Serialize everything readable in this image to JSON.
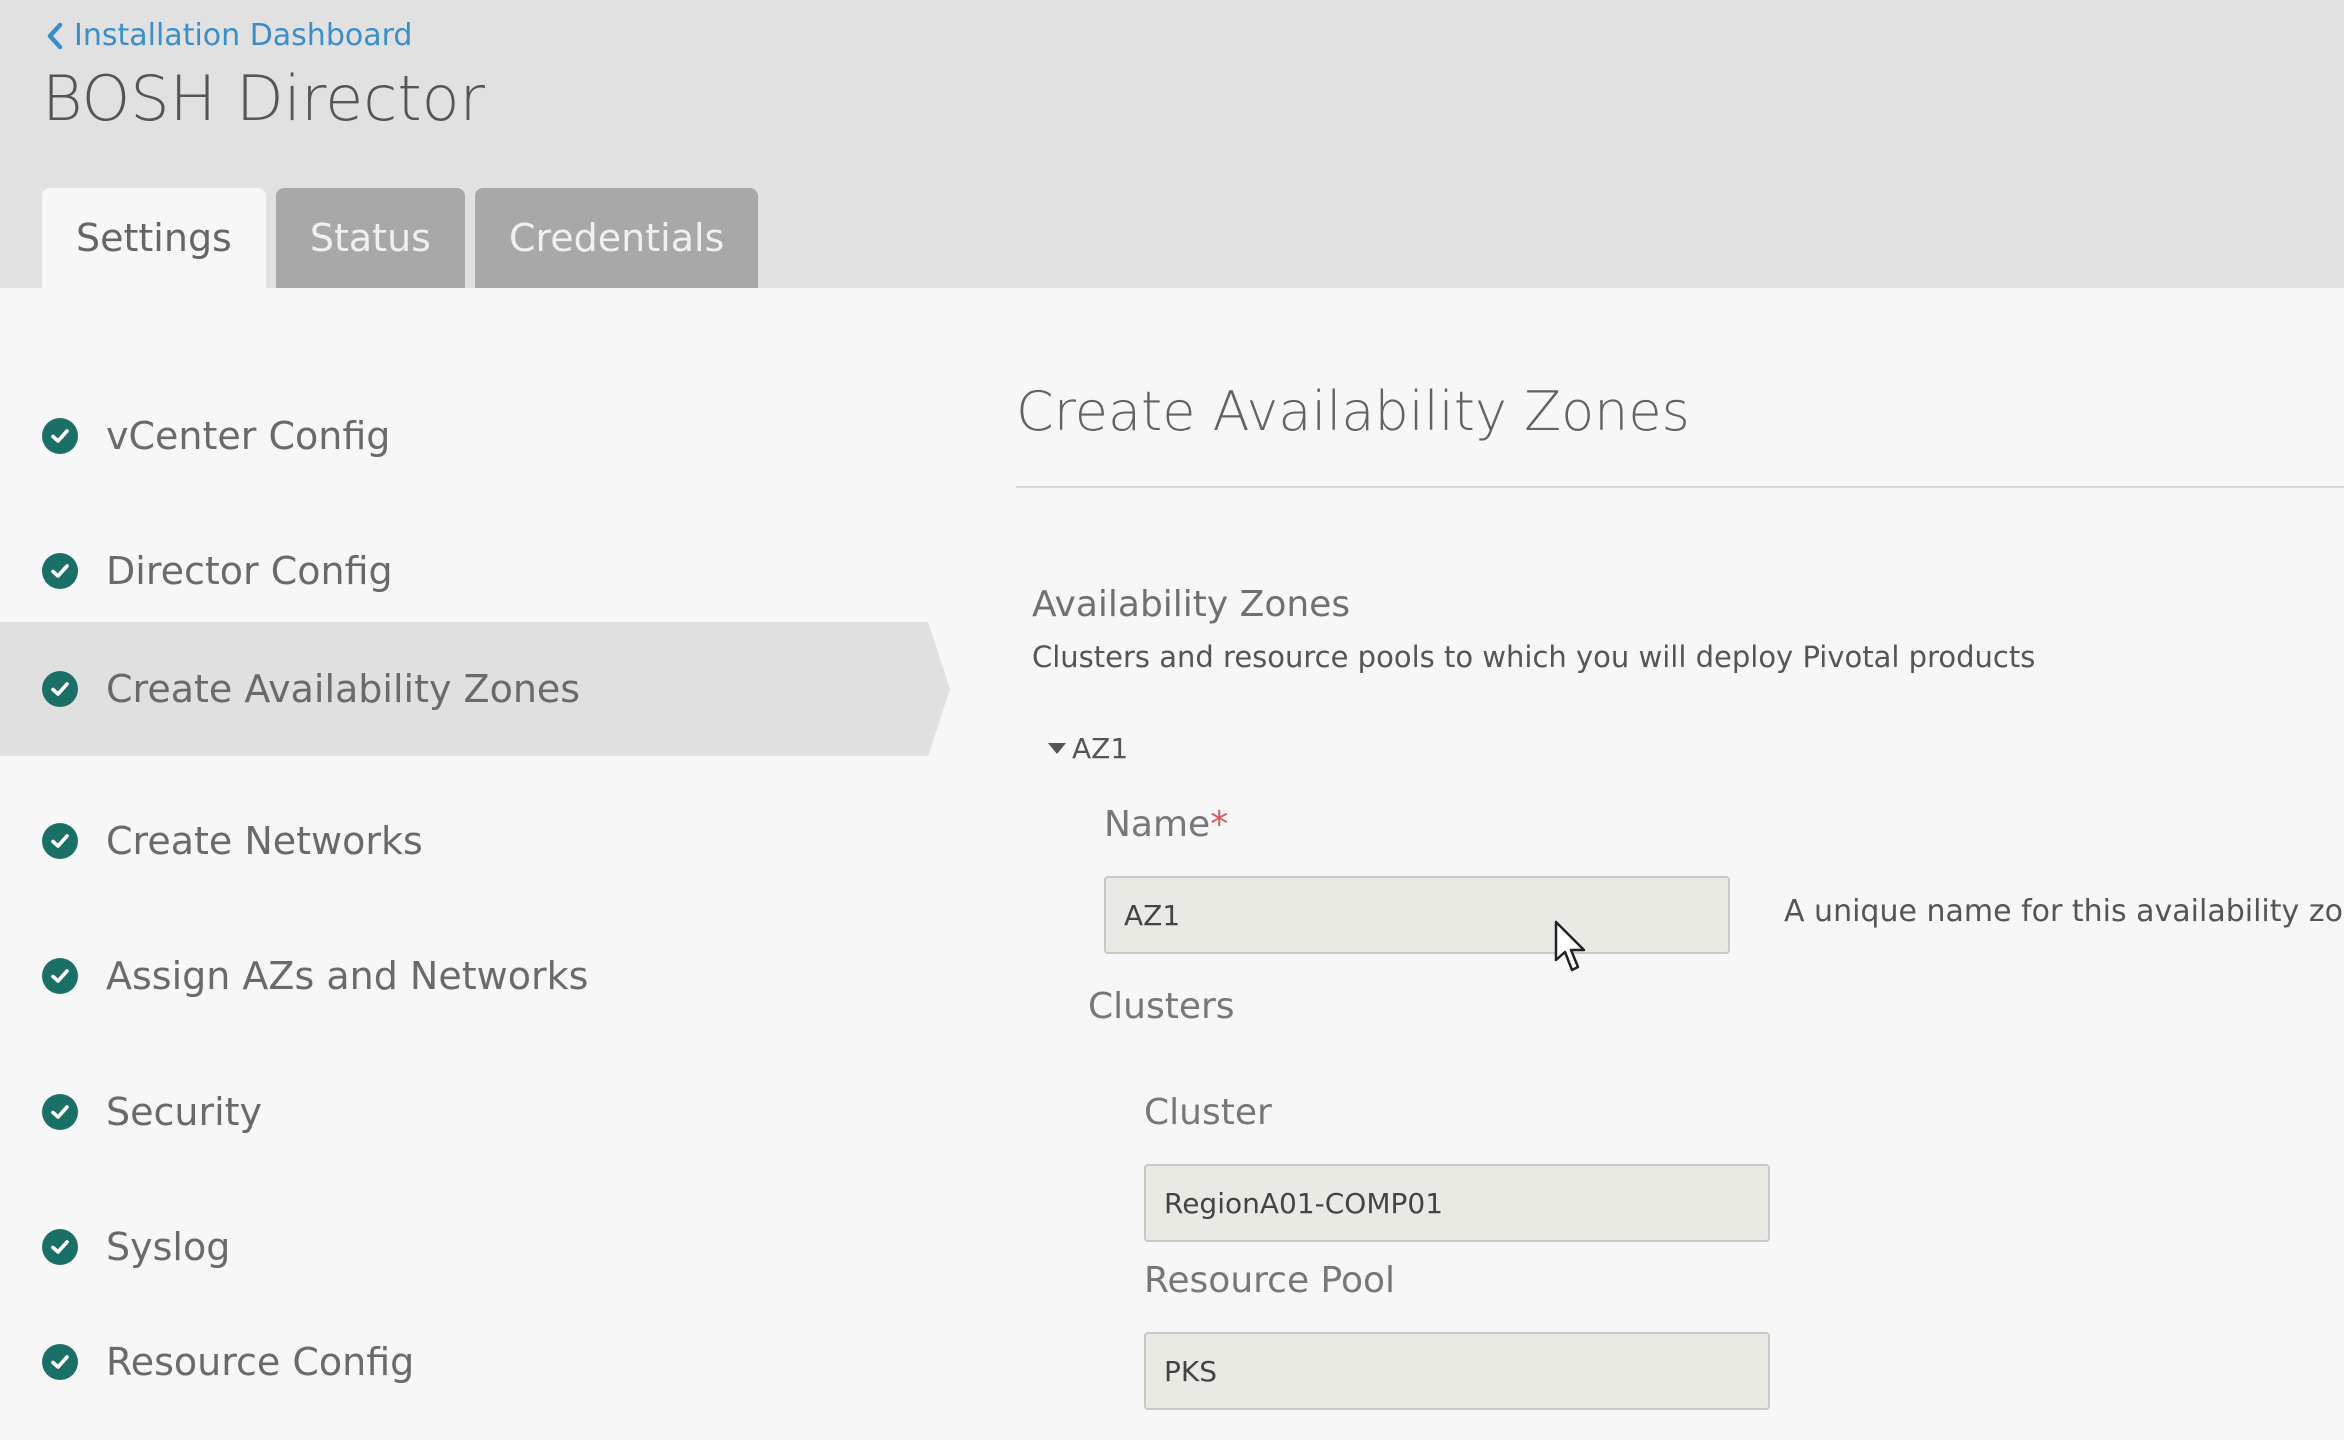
{
  "header": {
    "back_link": "Installation Dashboard",
    "title": "BOSH Director",
    "tabs": [
      {
        "label": "Settings",
        "active": true
      },
      {
        "label": "Status",
        "active": false
      },
      {
        "label": "Credentials",
        "active": false
      }
    ]
  },
  "sidebar": {
    "items": [
      {
        "label": "vCenter Config",
        "status": "complete"
      },
      {
        "label": "Director Config",
        "status": "complete"
      },
      {
        "label": "Create Availability Zones",
        "status": "complete",
        "active": true
      },
      {
        "label": "Create Networks",
        "status": "complete"
      },
      {
        "label": "Assign AZs and Networks",
        "status": "complete"
      },
      {
        "label": "Security",
        "status": "complete"
      },
      {
        "label": "Syslog",
        "status": "complete"
      },
      {
        "label": "Resource Config",
        "status": "complete"
      }
    ]
  },
  "main": {
    "section_title": "Create Availability Zones",
    "az_heading": "Availability Zones",
    "az_description": "Clusters and resource pools to which you will deploy Pivotal products",
    "az_toggle_label": "AZ1",
    "name_label": "Name",
    "required_marker": "*",
    "name_value": "AZ1",
    "name_hint": "A unique name for this availability zone",
    "clusters_label": "Clusters",
    "cluster_label": "Cluster",
    "cluster_value": "RegionA01-COMP01",
    "resource_pool_label": "Resource Pool",
    "resource_pool_value": "PKS"
  },
  "colors": {
    "header_bg": "#e1e1e1",
    "page_bg": "#f7f7f7",
    "link": "#3a8fc8",
    "check": "#1a6f66",
    "tab_inactive": "#a8a8a8",
    "required": "#d45a5a"
  },
  "icons": {
    "back": "chevron-left-icon",
    "status": "check-circle-icon",
    "expand": "triangle-down-icon",
    "pointer": "mouse-cursor-icon"
  }
}
